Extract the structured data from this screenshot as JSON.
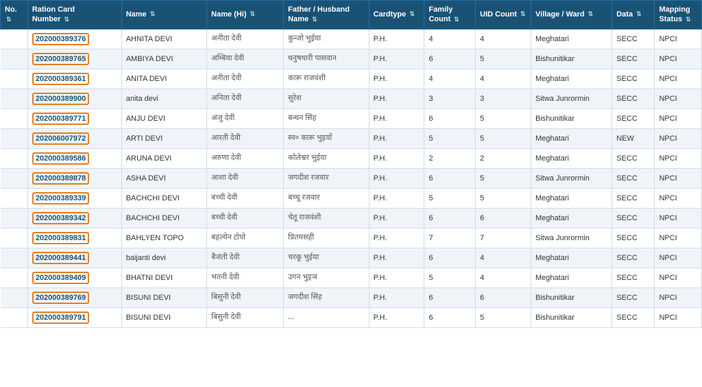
{
  "colors": {
    "header_bg": "#1a5276",
    "header_text": "#ffffff",
    "highlight_border": "#e67e22",
    "row_even": "#f0f4f8",
    "row_odd": "#ffffff"
  },
  "table": {
    "columns": [
      {
        "id": "no",
        "label": "No.",
        "sort": true
      },
      {
        "id": "ration",
        "label": "Ration Card Number",
        "sort": true
      },
      {
        "id": "name",
        "label": "Name",
        "sort": true
      },
      {
        "id": "nameh",
        "label": "Name (Hi)",
        "sort": true
      },
      {
        "id": "father",
        "label": "Father / Husband Name",
        "sort": true
      },
      {
        "id": "cardtype",
        "label": "Cardtype",
        "sort": true
      },
      {
        "id": "family",
        "label": "Family Count",
        "sort": true
      },
      {
        "id": "uid",
        "label": "UID Count",
        "sort": true
      },
      {
        "id": "village",
        "label": "Village / Ward",
        "sort": true
      },
      {
        "id": "data",
        "label": "Data",
        "sort": true
      },
      {
        "id": "mapp",
        "label": "Mapping Status",
        "sort": true
      }
    ],
    "rows": [
      {
        "no": "",
        "ration": "202000389376",
        "name": "AHNITA DEVI",
        "nameh": "अनीता देवी",
        "father": "कुन्जो भुईया",
        "cardtype": "P.H.",
        "family": "4",
        "uid": "4",
        "village": "Meghatari",
        "data": "SECC",
        "mapp": "NPCI"
      },
      {
        "no": "",
        "ration": "202000389765",
        "name": "AMBIYA DEVI",
        "nameh": "अम्बिया देवी",
        "father": "धनुषधारी पासवान",
        "cardtype": "P.H.",
        "family": "6",
        "uid": "5",
        "village": "Bishunitikar",
        "data": "SECC",
        "mapp": "NPCI"
      },
      {
        "no": "",
        "ration": "202000389361",
        "name": "ANITA DEVI",
        "nameh": "अनीता देवी",
        "father": "कारू राजवंशी",
        "cardtype": "P.H.",
        "family": "4",
        "uid": "4",
        "village": "Meghatari",
        "data": "SECC",
        "mapp": "NPCI"
      },
      {
        "no": "",
        "ration": "202000389900",
        "name": "anita devi",
        "nameh": "अनिता देवी",
        "father": "सुरेश",
        "cardtype": "P.H.",
        "family": "3",
        "uid": "3",
        "village": "Sitwa Junrormin",
        "data": "SECC",
        "mapp": "NPCI"
      },
      {
        "no": "",
        "ration": "202000389771",
        "name": "ANJU DEVI",
        "nameh": "अंजु देवी",
        "father": "बन्धन सिंह",
        "cardtype": "P.H.",
        "family": "6",
        "uid": "5",
        "village": "Bishunitikar",
        "data": "SECC",
        "mapp": "NPCI"
      },
      {
        "no": "",
        "ration": "202006007972",
        "name": "ARTI DEVI",
        "nameh": "आरती देवी",
        "father": "स्व० कारू भुइयाँ",
        "cardtype": "P.H.",
        "family": "5",
        "uid": "5",
        "village": "Meghatari",
        "data": "NEW",
        "mapp": "NPCI"
      },
      {
        "no": "",
        "ration": "202000389586",
        "name": "ARUNA DEVI",
        "nameh": "अरुणा देवी",
        "father": "कोलेश्वर भुईया",
        "cardtype": "P.H.",
        "family": "2",
        "uid": "2",
        "village": "Meghatari",
        "data": "SECC",
        "mapp": "NPCI"
      },
      {
        "no": "",
        "ration": "202000389878",
        "name": "ASHA DEVI",
        "nameh": "आशा देवी",
        "father": "जगदीश रजवार",
        "cardtype": "P.H.",
        "family": "6",
        "uid": "5",
        "village": "Sitwa Junrormin",
        "data": "SECC",
        "mapp": "NPCI"
      },
      {
        "no": "",
        "ration": "202000389339",
        "name": "BACHCHI DEVI",
        "nameh": "बच्ची देवी",
        "father": "बच्चू रजवार",
        "cardtype": "P.H.",
        "family": "5",
        "uid": "5",
        "village": "Meghatari",
        "data": "SECC",
        "mapp": "NPCI"
      },
      {
        "no": "",
        "ration": "202000389342",
        "name": "BACHCHI DEVI",
        "nameh": "बच्ची देवी",
        "father": "चेतू राजवंशी",
        "cardtype": "P.H.",
        "family": "6",
        "uid": "6",
        "village": "Meghatari",
        "data": "SECC",
        "mapp": "NPCI"
      },
      {
        "no": "",
        "ration": "202000389831",
        "name": "BAHLYEN TOPO",
        "nameh": "बहल्येन टोपो",
        "father": "प्रितमसही",
        "cardtype": "P.H.",
        "family": "7",
        "uid": "7",
        "village": "Sitwa Junrormin",
        "data": "SECC",
        "mapp": "NPCI"
      },
      {
        "no": "",
        "ration": "202000389441",
        "name": "baijanti devi",
        "nameh": "बैजंती देवी",
        "father": "चरकू भुईया",
        "cardtype": "P.H.",
        "family": "6",
        "uid": "4",
        "village": "Meghatari",
        "data": "SECC",
        "mapp": "NPCI"
      },
      {
        "no": "",
        "ration": "202000389409",
        "name": "BHATNI DEVI",
        "nameh": "भतनी देवी",
        "father": "उगन भुइञ",
        "cardtype": "P.H.",
        "family": "5",
        "uid": "4",
        "village": "Meghatari",
        "data": "SECC",
        "mapp": "NPCI"
      },
      {
        "no": "",
        "ration": "202000389769",
        "name": "BISUNI DEVI",
        "nameh": "बिसुनी देवी",
        "father": "जगदीश सिंह",
        "cardtype": "P.H.",
        "family": "6",
        "uid": "6",
        "village": "Bishunitikar",
        "data": "SECC",
        "mapp": "NPCI"
      },
      {
        "no": "",
        "ration": "202000389791",
        "name": "BISUNI DEVI",
        "nameh": "बिसुनी देवी",
        "father": "...",
        "cardtype": "P.H.",
        "family": "6",
        "uid": "5",
        "village": "Bishunitikar",
        "data": "SECC",
        "mapp": "NPCI"
      }
    ]
  }
}
